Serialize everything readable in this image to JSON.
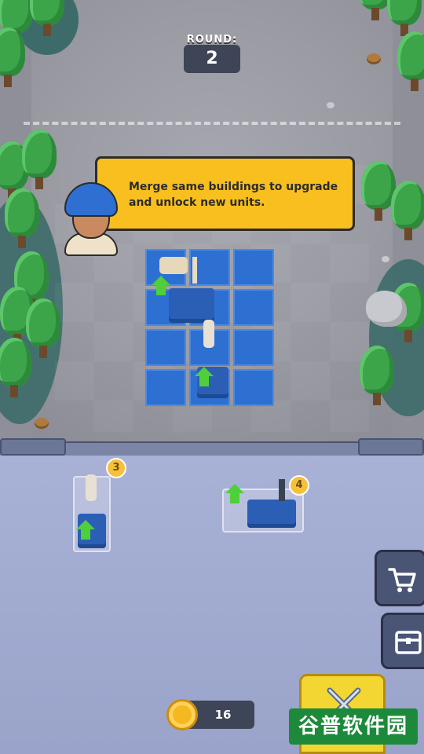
{
  "round": {
    "label": "ROUND:",
    "value": "2"
  },
  "tutorial": {
    "message": "Merge same buildings to upgrade and unlock new units."
  },
  "bench": {
    "units": [
      {
        "type": "soldier-tower",
        "level": "3"
      },
      {
        "type": "cannon-base",
        "level": "4"
      }
    ]
  },
  "side_buttons": {
    "shop": {
      "icon": "cart-icon"
    },
    "chest": {
      "icon": "chest-icon"
    }
  },
  "battle_button": {
    "icon": "crossed-swords-icon"
  },
  "currency": {
    "coins": "16",
    "icon": "coin-icon"
  },
  "watermark": {
    "text": "谷普软件园"
  },
  "colors": {
    "tile_blue": "#2e6fd2",
    "bubble_yellow": "#f8bf1f",
    "battle_yellow": "#f4d633",
    "upgrade_green": "#4fd03a"
  }
}
